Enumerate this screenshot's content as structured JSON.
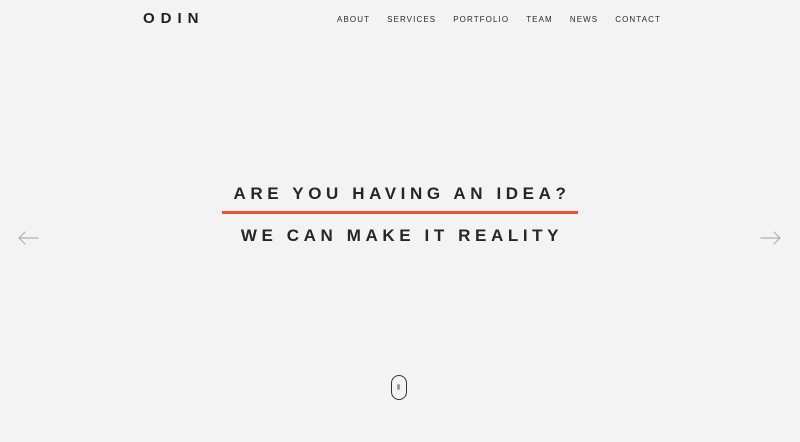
{
  "header": {
    "logo": "ODIN",
    "nav": [
      "ABOUT",
      "SERVICES",
      "PORTFOLIO",
      "TEAM",
      "NEWS",
      "CONTACT"
    ]
  },
  "hero": {
    "headline": "ARE YOU HAVING AN IDEA?",
    "subline": "WE CAN MAKE IT REALITY"
  },
  "colors": {
    "background": "#f4f3f3",
    "accent": "#e8532e",
    "text": "#262626"
  },
  "icons": {
    "prev": "arrow-left-icon",
    "next": "arrow-right-icon",
    "scroll": "mouse-scroll-icon"
  }
}
